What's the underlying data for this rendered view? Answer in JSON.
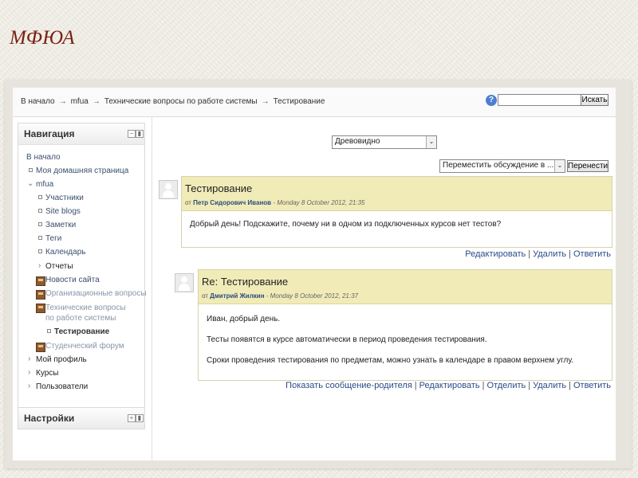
{
  "slide": {
    "title": "МФЮА"
  },
  "breadcrumb": {
    "items": [
      "В начало",
      "mfua",
      "Технические вопросы по работе системы",
      "Тестирование"
    ],
    "separator": "→"
  },
  "search": {
    "value": "",
    "placeholder": "",
    "button": "Искать",
    "help_icon": "?"
  },
  "navigation": {
    "title": "Навигация",
    "home": "В начало",
    "my_home": "Моя домашняя страница",
    "course": "mfua",
    "course_items": [
      "Участники",
      "Site blogs",
      "Заметки",
      "Теги",
      "Календарь"
    ],
    "reports": "Отчеты",
    "forums": [
      "Новости сайта",
      "Организационные вопросы",
      "Технические вопросы по работе системы"
    ],
    "current": "Тестирование",
    "student_forum": "Студенческий форум",
    "my_profile": "Мой профиль",
    "courses": "Курсы",
    "users": "Пользователи"
  },
  "settings": {
    "title": "Настройки"
  },
  "display_mode": {
    "selected": "Древовидно"
  },
  "move_discussion": {
    "selected": "Переместить обсуждение в ...",
    "button": "Перенести"
  },
  "posts": [
    {
      "subject": "Тестирование",
      "from": "от",
      "author": "Петр Сидорович Иванов",
      "date": "- Monday 8 October 2012, 21:35",
      "body": [
        "Добрый день! Подскажите, почему ни в одном из подключенных курсов нет тестов?"
      ],
      "commands": [
        "Редактировать",
        "Удалить",
        "Ответить"
      ]
    },
    {
      "subject": "Re: Тестирование",
      "from": "от",
      "author": "Дмитрий Жилкин",
      "date": "- Monday 8 October 2012, 21:37",
      "body": [
        "Иван, добрый день.",
        "Тесты появятся в курсе автоматически в период проведения тестирования.",
        "Сроки проведения тестирования по предметам, можно узнать в календаре в правом верхнем углу."
      ],
      "commands": [
        "Показать сообщение-родителя",
        "Редактировать",
        "Отделить",
        "Удалить",
        "Ответить"
      ]
    }
  ],
  "icons": [
    "help-icon",
    "collapse-icon",
    "dock-icon",
    "expand-icon",
    "bullet-icon",
    "chevron-right-icon",
    "chevron-down-icon",
    "forum-icon",
    "avatar",
    "dropdown-caret-icon"
  ]
}
